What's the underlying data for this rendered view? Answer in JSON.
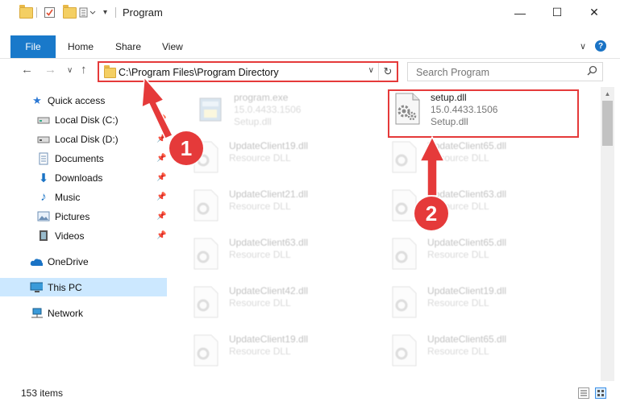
{
  "window": {
    "title": "Program",
    "minimize_glyph": "—",
    "maximize_glyph": "☐",
    "close_glyph": "✕"
  },
  "ribbon": {
    "tabs": [
      "File",
      "Home",
      "Share",
      "View"
    ]
  },
  "address": {
    "path": "C:\\Program Files\\Program Directory",
    "refresh_glyph": "↻",
    "dropdown_glyph": "∨"
  },
  "search": {
    "placeholder": "Search Program"
  },
  "sidebar": {
    "items": [
      {
        "label": "Quick access",
        "icon": "star-icon"
      },
      {
        "label": "Local Disk (C:)",
        "icon": "drive-icon"
      },
      {
        "label": "Local Disk (D:)",
        "icon": "drive-icon"
      },
      {
        "label": "Documents",
        "icon": "documents-icon"
      },
      {
        "label": "Downloads",
        "icon": "downloads-icon"
      },
      {
        "label": "Music",
        "icon": "music-icon"
      },
      {
        "label": "Pictures",
        "icon": "pictures-icon"
      },
      {
        "label": "Videos",
        "icon": "videos-icon"
      },
      {
        "label": "OneDrive",
        "icon": "cloud-icon"
      },
      {
        "label": "This PC",
        "icon": "computer-icon"
      },
      {
        "label": "Network",
        "icon": "network-icon"
      }
    ]
  },
  "files": [
    {
      "name": "program.exe",
      "line2": "15.0.4433.1506",
      "line3": "Setup.dll"
    },
    {
      "name": "setup.dll",
      "line2": "15.0.4433.1506",
      "line3": "Setup.dll"
    },
    {
      "name": "UpdateClient19.dll",
      "line2": "Resource DLL"
    },
    {
      "name": "UpdateClient65.dll",
      "line2": "Resource DLL"
    },
    {
      "name": "UpdateClient21.dll",
      "line2": "Resource DLL"
    },
    {
      "name": "UpdateClient63.dll",
      "line2": "Resource DLL"
    },
    {
      "name": "UpdateClient63.dll",
      "line2": "Resource DLL"
    },
    {
      "name": "UpdateClient65.dll",
      "line2": "Resource DLL"
    },
    {
      "name": "UpdateClient42.dll",
      "line2": "Resource DLL"
    },
    {
      "name": "UpdateClient19.dll",
      "line2": "Resource DLL"
    },
    {
      "name": "UpdateClient19.dll",
      "line2": "Resource DLL"
    },
    {
      "name": "UpdateClient65.dll",
      "line2": "Resource DLL"
    }
  ],
  "status": {
    "item_count": "153 items"
  },
  "annotations": {
    "badge1": "1",
    "badge2": "2"
  },
  "colors": {
    "accent": "#1979ca",
    "highlight": "#e53a3a",
    "selected": "#cce8ff"
  }
}
